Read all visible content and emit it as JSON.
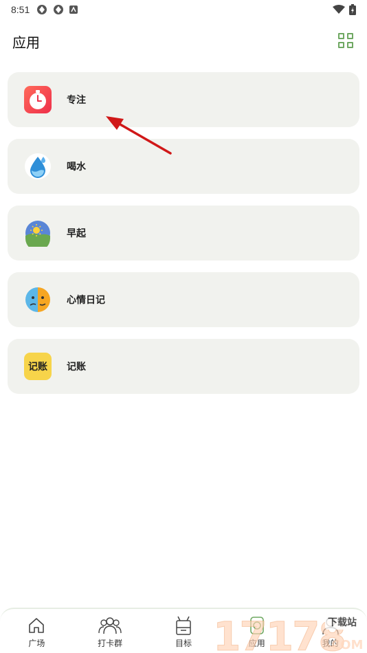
{
  "status_bar": {
    "time": "8:51"
  },
  "header": {
    "title": "应用"
  },
  "apps": [
    {
      "label": "专注",
      "icon": "tomato-timer-icon"
    },
    {
      "label": "喝水",
      "icon": "water-drop-icon"
    },
    {
      "label": "早起",
      "icon": "sunrise-icon"
    },
    {
      "label": "心情日记",
      "icon": "mood-face-icon"
    },
    {
      "label": "记账",
      "icon": "bookkeeping-icon",
      "icon_text": "记账"
    }
  ],
  "bottom_nav": [
    {
      "label": "广场",
      "icon": "home-icon"
    },
    {
      "label": "打卡群",
      "icon": "group-icon"
    },
    {
      "label": "目标",
      "icon": "target-icon"
    },
    {
      "label": "应用",
      "icon": "apps-icon",
      "active": true
    },
    {
      "label": "我的",
      "icon": "profile-icon"
    }
  ],
  "watermark": {
    "digits": "17178",
    "badge": "下载站",
    "suffix": "COM"
  },
  "colors": {
    "accent": "#6fa862",
    "card_bg": "#f1f2ee",
    "arrow": "#d01818"
  }
}
